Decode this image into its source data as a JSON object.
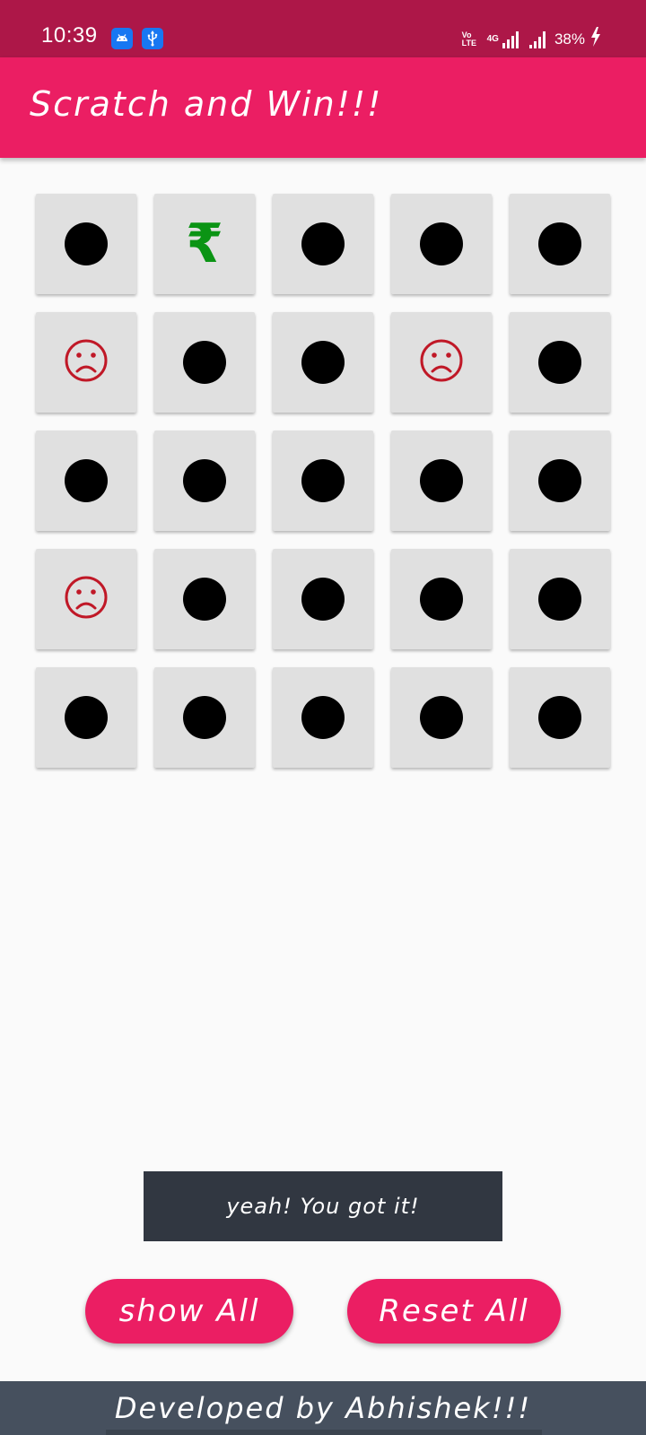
{
  "status_bar": {
    "time": "10:39",
    "volte_top": "Vo",
    "volte_bottom": "LTE",
    "network": "4G",
    "battery": "38%",
    "icons": [
      "android-icon",
      "usb-icon",
      "volte-icon",
      "signal-icon",
      "signal-icon",
      "battery-charging-icon"
    ]
  },
  "app_bar": {
    "title": "Scratch and Win!!!"
  },
  "grid": {
    "rows": 5,
    "columns": 5,
    "cells": [
      "hidden",
      "rupee",
      "hidden",
      "hidden",
      "hidden",
      "sad",
      "hidden",
      "hidden",
      "sad",
      "hidden",
      "hidden",
      "hidden",
      "hidden",
      "hidden",
      "hidden",
      "sad",
      "hidden",
      "hidden",
      "hidden",
      "hidden",
      "hidden",
      "hidden",
      "hidden",
      "hidden",
      "hidden"
    ],
    "rupee_symbol": "₹"
  },
  "toast": {
    "message": "yeah! You got it!"
  },
  "buttons": {
    "show_all": "show All",
    "reset_all": "Reset All"
  },
  "footer": {
    "text": "Developed by Abhishek!!!"
  },
  "colors": {
    "status_bar": "#ad1748",
    "accent": "#eb1e63",
    "tile": "#e0e0e0",
    "rupee": "#0b9414",
    "sad_face": "#c01827",
    "toast": "#313741",
    "footer": "#46505e"
  }
}
